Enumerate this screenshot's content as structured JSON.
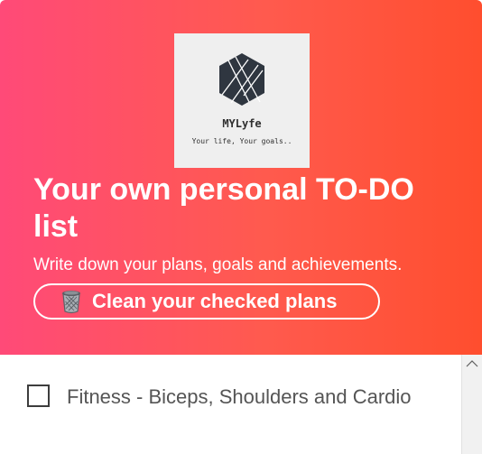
{
  "hero": {
    "logo": {
      "name": "MYLyfe",
      "tagline": "Your life, Your goals.."
    },
    "title": "Your own personal TO-DO list",
    "subtitle": "Write down your plans, goals and achievements.",
    "clean_button": {
      "icon": "trash-icon",
      "label": "Clean your checked plans"
    }
  },
  "todos": [
    {
      "text": "Fitness - Biceps, Shoulders and Cardio",
      "checked": false
    }
  ],
  "colors": {
    "gradient_start": "#ff4a78",
    "gradient_end": "#ff4e2e",
    "logo_bg": "#efefef",
    "logo_ink": "#2f3640",
    "todo_text": "#555555"
  }
}
